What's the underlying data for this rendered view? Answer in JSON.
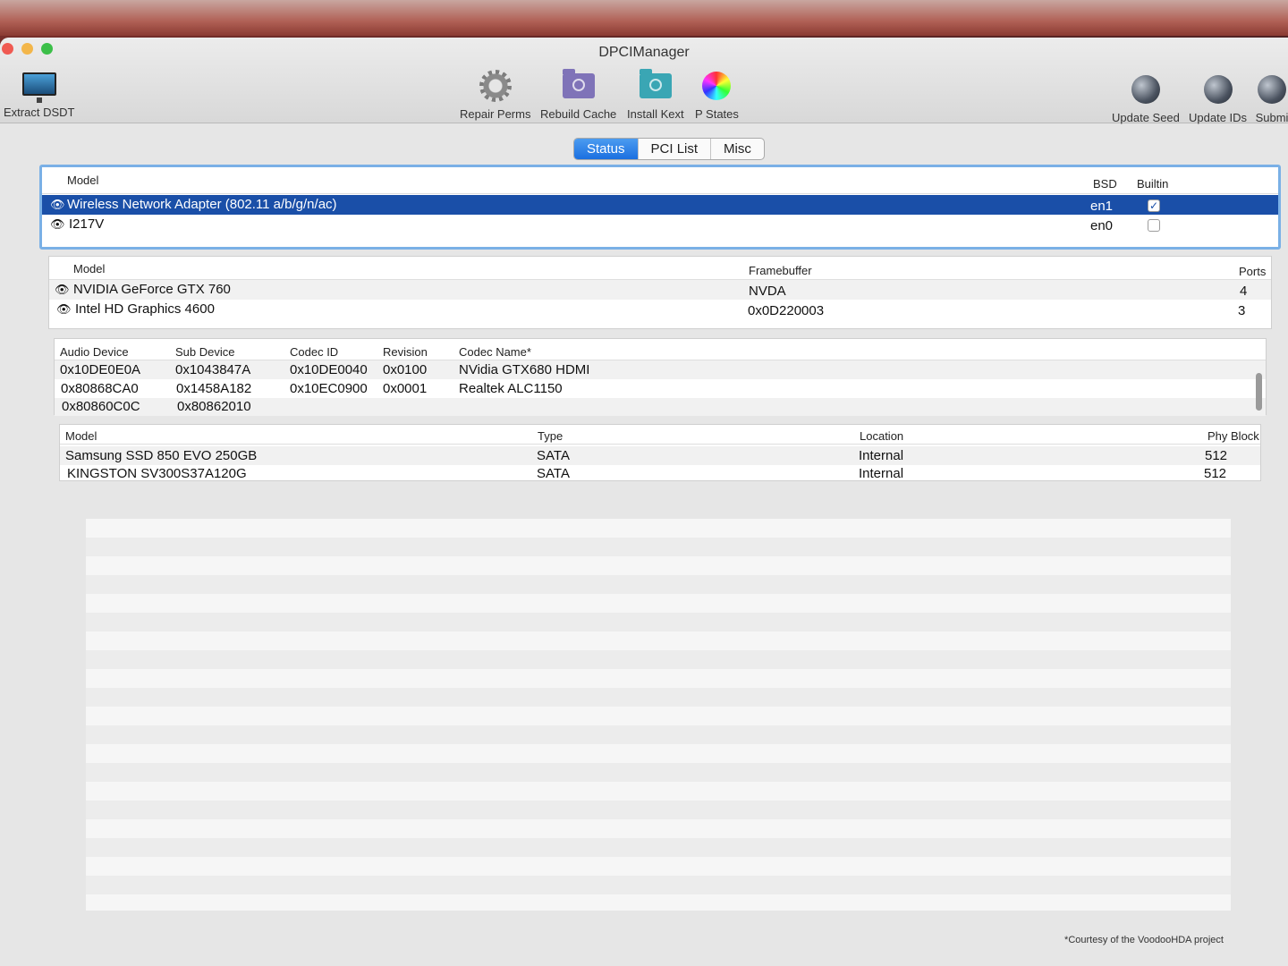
{
  "window": {
    "title": "DPCIManager"
  },
  "toolbar": {
    "extract_dsdt": "Extract DSDT",
    "repair_perms": "Repair Perms",
    "rebuild_cache": "Rebuild Cache",
    "install_kext": "Install Kext",
    "p_states": "P States",
    "update_seed": "Update Seed",
    "update_ids": "Update IDs",
    "submit": "Submi"
  },
  "tabs": [
    "Status",
    "PCI List",
    "Misc"
  ],
  "network": {
    "headers": {
      "model": "Model",
      "bsd": "BSD",
      "builtin": "Builtin"
    },
    "rows": [
      {
        "model": "Wireless Network Adapter (802.11 a/b/g/n/ac)",
        "bsd": "en1",
        "builtin": "✓"
      },
      {
        "model": "I217V",
        "bsd": "en0",
        "builtin": ""
      }
    ]
  },
  "graphics": {
    "headers": {
      "model": "Model",
      "framebuffer": "Framebuffer",
      "ports": "Ports"
    },
    "rows": [
      {
        "model": "NVIDIA GeForce GTX 760",
        "framebuffer": "NVDA",
        "ports": "4"
      },
      {
        "model": "Intel HD Graphics 4600",
        "framebuffer": "0x0D220003",
        "ports": "3"
      }
    ]
  },
  "audio": {
    "headers": {
      "device": "Audio Device",
      "sub": "Sub Device",
      "codec_id": "Codec ID",
      "revision": "Revision",
      "codec_name": "Codec Name*"
    },
    "rows": [
      {
        "device": "0x10DE0E0A",
        "sub": "0x1043847A",
        "codec_id": "0x10DE0040",
        "revision": "0x0100",
        "codec_name": "NVidia GTX680 HDMI"
      },
      {
        "device": "0x80868CA0",
        "sub": "0x1458A182",
        "codec_id": "0x10EC0900",
        "revision": "0x0001",
        "codec_name": "Realtek ALC1150"
      },
      {
        "device": "0x80860C0C",
        "sub": "0x80862010",
        "codec_id": "",
        "revision": "",
        "codec_name": ""
      }
    ]
  },
  "storage": {
    "headers": {
      "model": "Model",
      "type": "Type",
      "location": "Location",
      "phy_block": "Phy Block"
    },
    "rows": [
      {
        "model": "Samsung SSD 850 EVO 250GB",
        "type": "SATA",
        "location": "Internal",
        "phy_block": "512"
      },
      {
        "model": "KINGSTON SV300S37A120G",
        "type": "SATA",
        "location": "Internal",
        "phy_block": "512"
      }
    ]
  },
  "footnote": "*Courtesy of the VoodooHDA project"
}
